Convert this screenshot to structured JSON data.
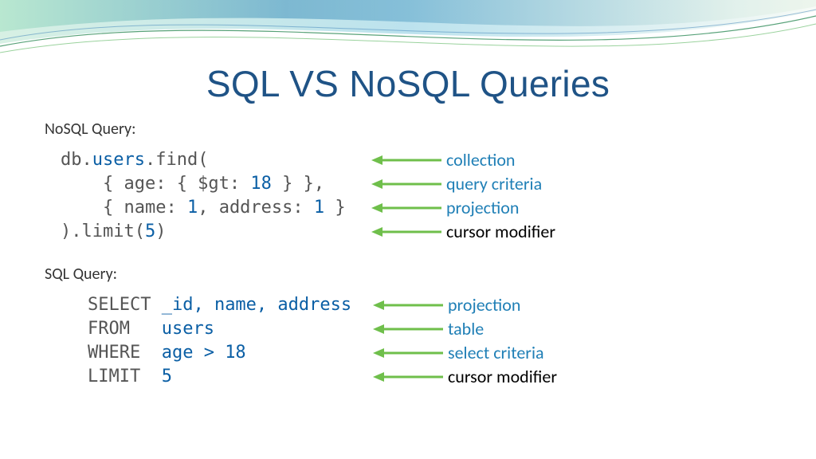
{
  "title": "SQL VS NoSQL Queries",
  "labels": {
    "nosql": "NoSQL Query:",
    "sql": "SQL Query:"
  },
  "nosql": {
    "lines": [
      {
        "pre": "db.",
        "hi": "users",
        "mid": ".find(",
        "ann": "collection",
        "anncls": "blue"
      },
      {
        "pre": "    { age: { $gt: ",
        "hi": "18",
        "mid": " } },",
        "ann": "query criteria",
        "anncls": "blue"
      },
      {
        "pre": "    { name: ",
        "hi": "1",
        "mid": ", address: ",
        "hi2": "1",
        "mid2": " }",
        "ann": "projection",
        "anncls": "blue"
      },
      {
        "pre": ").limit(",
        "hi": "5",
        "mid": ")",
        "ann": "cursor modifier",
        "anncls": "black"
      }
    ]
  },
  "sql": {
    "lines": [
      {
        "kw": "SELECT",
        "arg": "_id, name, address",
        "argcls": "blue",
        "ann": "projection",
        "anncls": "blue"
      },
      {
        "kw": "FROM",
        "arg": "users",
        "argcls": "blue",
        "ann": "table",
        "anncls": "blue"
      },
      {
        "kw": "WHERE",
        "arg": "age > 18",
        "argcls": "blue",
        "ann": "select criteria",
        "anncls": "blue"
      },
      {
        "kw": "LIMIT",
        "arg": "5",
        "argcls": "blue",
        "ann": "cursor modifier",
        "anncls": "black"
      }
    ]
  }
}
